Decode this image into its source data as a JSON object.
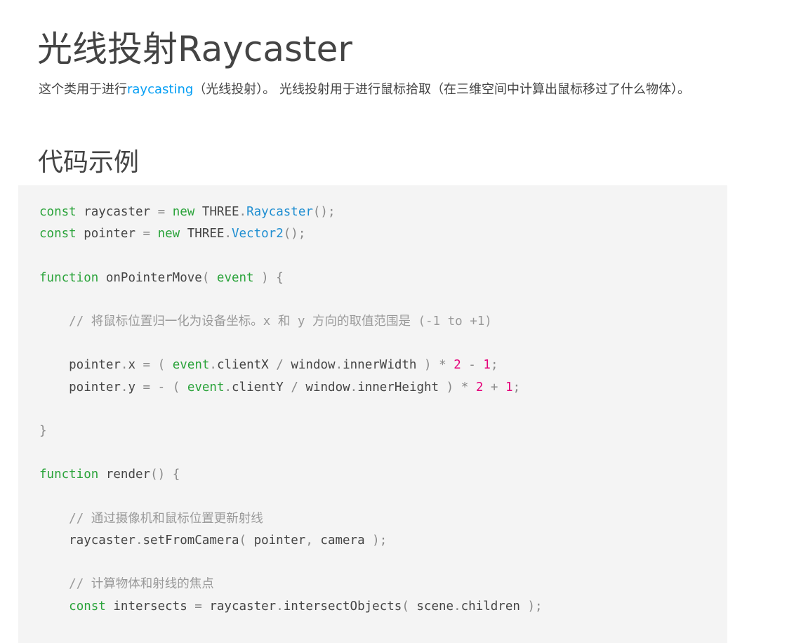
{
  "page": {
    "title": "光线投射Raycaster",
    "intro_before_link": "这个类用于进行",
    "intro_link": "raycasting",
    "intro_after_link": "（光线投射）。 光线投射用于进行鼠标拾取（在三维空间中计算出鼠标移过了什么物体）。",
    "section_title": "代码示例"
  },
  "colors": {
    "link": "#049ef4",
    "keyword": "#2aa33a",
    "class": "#1f8ed1",
    "number": "#e5007a",
    "comment": "#999999",
    "code_background": "#f4f4f4"
  },
  "code": {
    "lines": [
      [
        {
          "t": "const",
          "c": "kw"
        },
        {
          "t": " raycaster "
        },
        {
          "t": "=",
          "c": "pun"
        },
        {
          "t": " "
        },
        {
          "t": "new",
          "c": "kw"
        },
        {
          "t": " THREE"
        },
        {
          "t": ".",
          "c": "pun"
        },
        {
          "t": "Raycaster",
          "c": "cls"
        },
        {
          "t": "();",
          "c": "pun"
        }
      ],
      [
        {
          "t": "const",
          "c": "kw"
        },
        {
          "t": " pointer "
        },
        {
          "t": "=",
          "c": "pun"
        },
        {
          "t": " "
        },
        {
          "t": "new",
          "c": "kw"
        },
        {
          "t": " THREE"
        },
        {
          "t": ".",
          "c": "pun"
        },
        {
          "t": "Vector2",
          "c": "cls"
        },
        {
          "t": "();",
          "c": "pun"
        }
      ],
      [],
      [
        {
          "t": "function",
          "c": "kw"
        },
        {
          "t": " onPointerMove"
        },
        {
          "t": "(",
          "c": "pun"
        },
        {
          "t": " "
        },
        {
          "t": "event",
          "c": "kw"
        },
        {
          "t": " "
        },
        {
          "t": ")",
          "c": "pun"
        },
        {
          "t": " "
        },
        {
          "t": "{",
          "c": "pun"
        }
      ],
      [],
      [
        {
          "t": "    "
        },
        {
          "t": "// 将鼠标位置归一化为设备坐标。x 和 y 方向的取值范围是 (-1 to +1)",
          "c": "cmt"
        }
      ],
      [],
      [
        {
          "t": "    pointer"
        },
        {
          "t": ".",
          "c": "pun"
        },
        {
          "t": "x "
        },
        {
          "t": "=",
          "c": "pun"
        },
        {
          "t": " "
        },
        {
          "t": "(",
          "c": "pun"
        },
        {
          "t": " "
        },
        {
          "t": "event",
          "c": "kw"
        },
        {
          "t": ".",
          "c": "pun"
        },
        {
          "t": "clientX "
        },
        {
          "t": "/",
          "c": "pun"
        },
        {
          "t": " window"
        },
        {
          "t": ".",
          "c": "pun"
        },
        {
          "t": "innerWidth "
        },
        {
          "t": ")",
          "c": "pun"
        },
        {
          "t": " "
        },
        {
          "t": "*",
          "c": "pun"
        },
        {
          "t": " "
        },
        {
          "t": "2",
          "c": "num"
        },
        {
          "t": " "
        },
        {
          "t": "-",
          "c": "pun"
        },
        {
          "t": " "
        },
        {
          "t": "1",
          "c": "num"
        },
        {
          "t": ";",
          "c": "pun"
        }
      ],
      [
        {
          "t": "    pointer"
        },
        {
          "t": ".",
          "c": "pun"
        },
        {
          "t": "y "
        },
        {
          "t": "=",
          "c": "pun"
        },
        {
          "t": " "
        },
        {
          "t": "-",
          "c": "pun"
        },
        {
          "t": " "
        },
        {
          "t": "(",
          "c": "pun"
        },
        {
          "t": " "
        },
        {
          "t": "event",
          "c": "kw"
        },
        {
          "t": ".",
          "c": "pun"
        },
        {
          "t": "clientY "
        },
        {
          "t": "/",
          "c": "pun"
        },
        {
          "t": " window"
        },
        {
          "t": ".",
          "c": "pun"
        },
        {
          "t": "innerHeight "
        },
        {
          "t": ")",
          "c": "pun"
        },
        {
          "t": " "
        },
        {
          "t": "*",
          "c": "pun"
        },
        {
          "t": " "
        },
        {
          "t": "2",
          "c": "num"
        },
        {
          "t": " "
        },
        {
          "t": "+",
          "c": "pun"
        },
        {
          "t": " "
        },
        {
          "t": "1",
          "c": "num"
        },
        {
          "t": ";",
          "c": "pun"
        }
      ],
      [],
      [
        {
          "t": "}",
          "c": "pun"
        }
      ],
      [],
      [
        {
          "t": "function",
          "c": "kw"
        },
        {
          "t": " render"
        },
        {
          "t": "()",
          "c": "pun"
        },
        {
          "t": " "
        },
        {
          "t": "{",
          "c": "pun"
        }
      ],
      [],
      [
        {
          "t": "    "
        },
        {
          "t": "// 通过摄像机和鼠标位置更新射线",
          "c": "cmt"
        }
      ],
      [
        {
          "t": "    raycaster"
        },
        {
          "t": ".",
          "c": "pun"
        },
        {
          "t": "setFromCamera"
        },
        {
          "t": "(",
          "c": "pun"
        },
        {
          "t": " pointer"
        },
        {
          "t": ",",
          "c": "pun"
        },
        {
          "t": " camera "
        },
        {
          "t": ");",
          "c": "pun"
        }
      ],
      [],
      [
        {
          "t": "    "
        },
        {
          "t": "// 计算物体和射线的焦点",
          "c": "cmt"
        }
      ],
      [
        {
          "t": "    "
        },
        {
          "t": "const",
          "c": "kw"
        },
        {
          "t": " intersects "
        },
        {
          "t": "=",
          "c": "pun"
        },
        {
          "t": " raycaster"
        },
        {
          "t": ".",
          "c": "pun"
        },
        {
          "t": "intersectObjects"
        },
        {
          "t": "(",
          "c": "pun"
        },
        {
          "t": " scene"
        },
        {
          "t": ".",
          "c": "pun"
        },
        {
          "t": "children "
        },
        {
          "t": ");",
          "c": "pun"
        }
      ]
    ]
  }
}
